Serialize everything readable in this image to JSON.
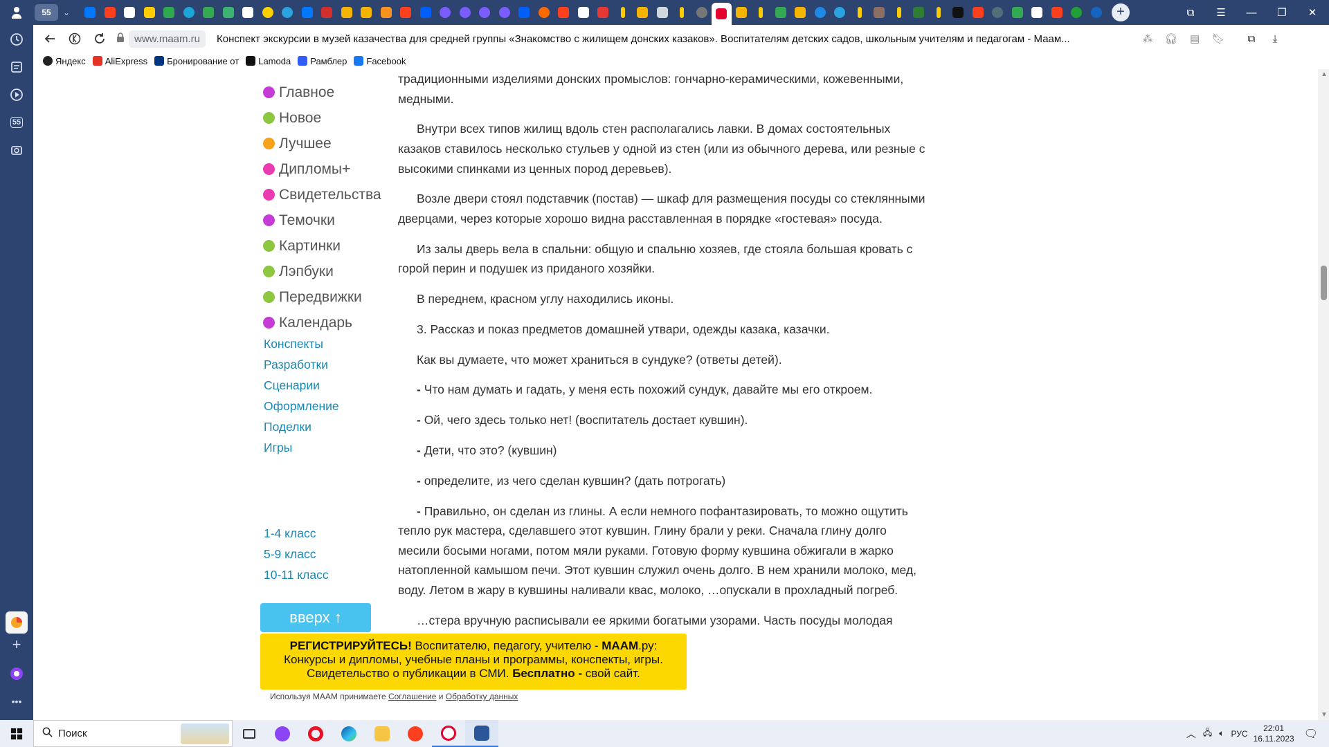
{
  "browser": {
    "tab_group_label": "55",
    "address": "www.maam.ru",
    "page_title": "Конспект экскурсии в музей казачества для средней группы «Знакомство с жилищем донских казаков». Воспитателям детских садов, школьным учителям и педагогам - Маам...",
    "sidepanel_badge": "55"
  },
  "bookmarks": [
    {
      "label": "Яндекс",
      "color": "#222222"
    },
    {
      "label": "AliExpress",
      "color": "#e43225"
    },
    {
      "label": "Бронирование от",
      "color": "#003580"
    },
    {
      "label": "Lamoda",
      "color": "#111111"
    },
    {
      "label": "Рамблер",
      "color": "#315efb"
    },
    {
      "label": "Facebook",
      "color": "#1877f2"
    }
  ],
  "sidebar_menu": [
    {
      "label": "Главное",
      "color": "#c43bd6"
    },
    {
      "label": "Новое",
      "color": "#8dc63f"
    },
    {
      "label": "Лучшее",
      "color": "#f7a21b"
    },
    {
      "label": "Дипломы+",
      "color": "#ec3bb0"
    },
    {
      "label": "Свидетельства",
      "color": "#ec3bb0"
    },
    {
      "label": "Темочки",
      "color": "#c43bd6"
    },
    {
      "label": "Картинки",
      "color": "#8dc63f"
    },
    {
      "label": "Лэпбуки",
      "color": "#8dc63f"
    },
    {
      "label": "Передвижки",
      "color": "#8dc63f"
    },
    {
      "label": "Календарь",
      "color": "#c43bd6"
    }
  ],
  "sidebar_links": [
    "Конспекты",
    "Разработки",
    "Сценарии",
    "Оформление",
    "Поделки",
    "Игры"
  ],
  "sidebar_grades": [
    "1-4 класс",
    "5-9 класс",
    "10-11 класс"
  ],
  "article": {
    "p0": "традиционными изделиями донских промыслов: гончарно-керамическими, кожевенными, медными.",
    "p1": "Внутри всех типов жилищ вдоль стен располагались лавки. В домах состоятельных казаков ставилось несколько стульев у одной из стен (или из обычного дерева, или резные с высокими спинками из ценных пород деревьев).",
    "p2": "Возле двери стоял подставчик (постав) — шкаф для размещения посуды со стеклянными дверцами, через которые хорошо видна расставленная в порядке «гостевая» посуда.",
    "p3": "Из залы дверь вела в спальни: общую и спальню хозяев, где стояла большая кровать с горой перин и подушек из приданого хозяйки.",
    "p4": "В переднем, красном углу находились иконы.",
    "p5": "3. Рассказ и показ предметов домашней утвари, одежды казака, казачки.",
    "p6": "Как вы думаете, что может храниться в сундуке? (ответы детей).",
    "dash": "-",
    "p7": " Что нам думать и гадать, у меня есть похожий сундук, давайте мы его откроем.",
    "p8": " Ой, чего здесь только нет! (воспитатель достает кувшин).",
    "p9": " Дети, что это? (кувшин)",
    "p10": " определите, из чего сделан кувшин? (дать потрогать)",
    "p11": " Правильно, он сделан из глины. А если немного пофантазировать, то можно ощутить тепло рук мастера, сделавшего этот кувшин. Глину брали у реки. Сначала глину долго месили босыми ногами, потом мяли руками. Готовую форму кувшина обжигали в жарко натопленной камышом печи. Этот кувшин служил очень долго. В нем хранили молоко, мед, воду. Летом в жару в кувшины наливали квас, молоко, …опускали в прохладный погреб.",
    "p12": "…стера вручную расписывали ее яркими богатыми узорами. Часть посуды молодая хозяйка приносила в дом мужа"
  },
  "up_button": "вверх ↑",
  "banner": {
    "reg": "РЕГИСТРИРУЙТЕСЬ!",
    "line1_mid": " Воспитателю, педагогу, учителю - ",
    "brand": "МААМ",
    "brand_suffix": ".ру:",
    "line2": "Конкурсы и дипломы, учебные планы и программы, конспекты, игры.",
    "line3_pre": "Свидетельство о публикации в СМИ. ",
    "free": "Бесплатно -",
    "line3_post": " свой сайт."
  },
  "consent": {
    "pre": "Используя МААМ принимаете ",
    "agreement": "Соглашение",
    "and": " и ",
    "processing": "Обработку данных"
  },
  "taskbar": {
    "search_placeholder": "Поиск",
    "lang": "РУС",
    "time": "22:01",
    "date": "16.11.2023"
  },
  "colors": {
    "browser_frame": "#2e4470",
    "link": "#1a88b3",
    "up_button": "#48c3f0",
    "banner": "#fdd700"
  }
}
